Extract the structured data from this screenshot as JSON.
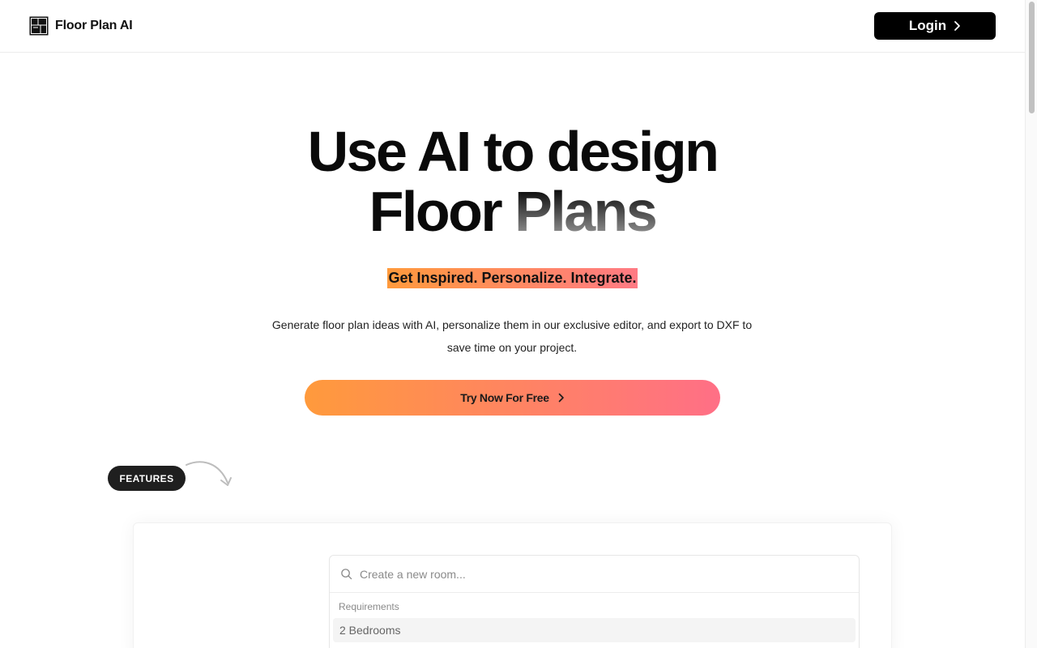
{
  "header": {
    "brand_name": "Floor Plan AI",
    "login_label": "Login"
  },
  "hero": {
    "title_line1": "Use AI to design",
    "title_line2_a": "Floor",
    "title_line2_b": "Plans",
    "tagline": "Get Inspired. Personalize. Integrate.",
    "description": "Generate floor plan ideas with AI, personalize them in our exclusive editor, and export to DXF to save time on your project.",
    "cta_label": "Try Now For Free"
  },
  "features": {
    "pill_label": "FEATURES"
  },
  "demo": {
    "search_placeholder": "Create a new room...",
    "group_label": "Requirements",
    "items": [
      "2 Bedrooms"
    ]
  },
  "colors": {
    "gradient_start": "#ff9a3c",
    "gradient_end": "#ff6f86",
    "primary": "#000000"
  }
}
